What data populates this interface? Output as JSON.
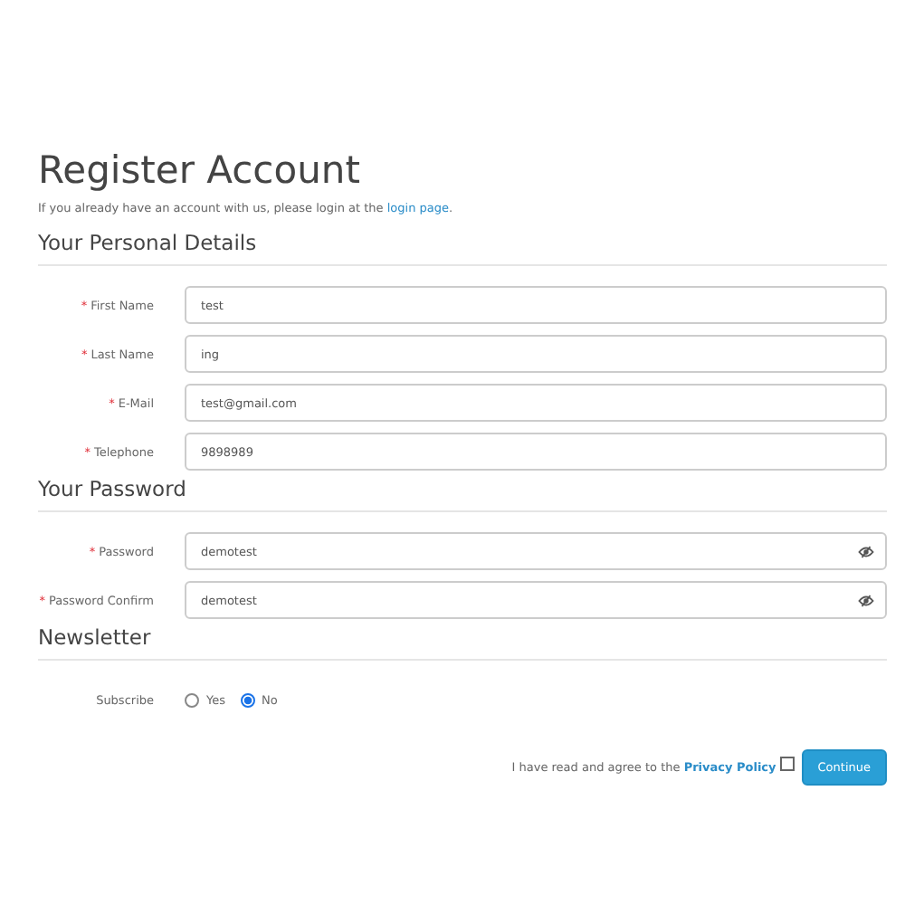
{
  "title": "Register Account",
  "intro": {
    "text": "If you already have an account with us, please login at the ",
    "link": "login page",
    "after": "."
  },
  "sections": [
    {
      "heading": "Your Personal Details",
      "fields": [
        {
          "label": "First Name",
          "required_mark": "*",
          "value": "test",
          "kind": "text"
        },
        {
          "label": "Last Name",
          "required_mark": "*",
          "value": "ing",
          "kind": "text"
        },
        {
          "label": "E-Mail",
          "required_mark": "*",
          "value": "test@gmail.com",
          "kind": "text"
        },
        {
          "label": "Telephone",
          "required_mark": "*",
          "value": "9898989",
          "kind": "text"
        }
      ]
    },
    {
      "heading": "Your Password",
      "fields": [
        {
          "label": "Password",
          "required_mark": "*",
          "value": "demotest",
          "kind": "password"
        },
        {
          "label": "Password Confirm",
          "required_mark": "*",
          "value": "demotest",
          "kind": "password"
        }
      ]
    },
    {
      "heading": "Newsletter",
      "fields": [
        {
          "label": "Subscribe",
          "kind": "radio",
          "options": [
            {
              "label": "Yes",
              "selected": false
            },
            {
              "label": "No",
              "selected": true
            }
          ]
        }
      ]
    }
  ],
  "agreement": {
    "text": "I have read and agree to the ",
    "link": "Privacy Policy",
    "checked": false
  },
  "button": "Continue"
}
